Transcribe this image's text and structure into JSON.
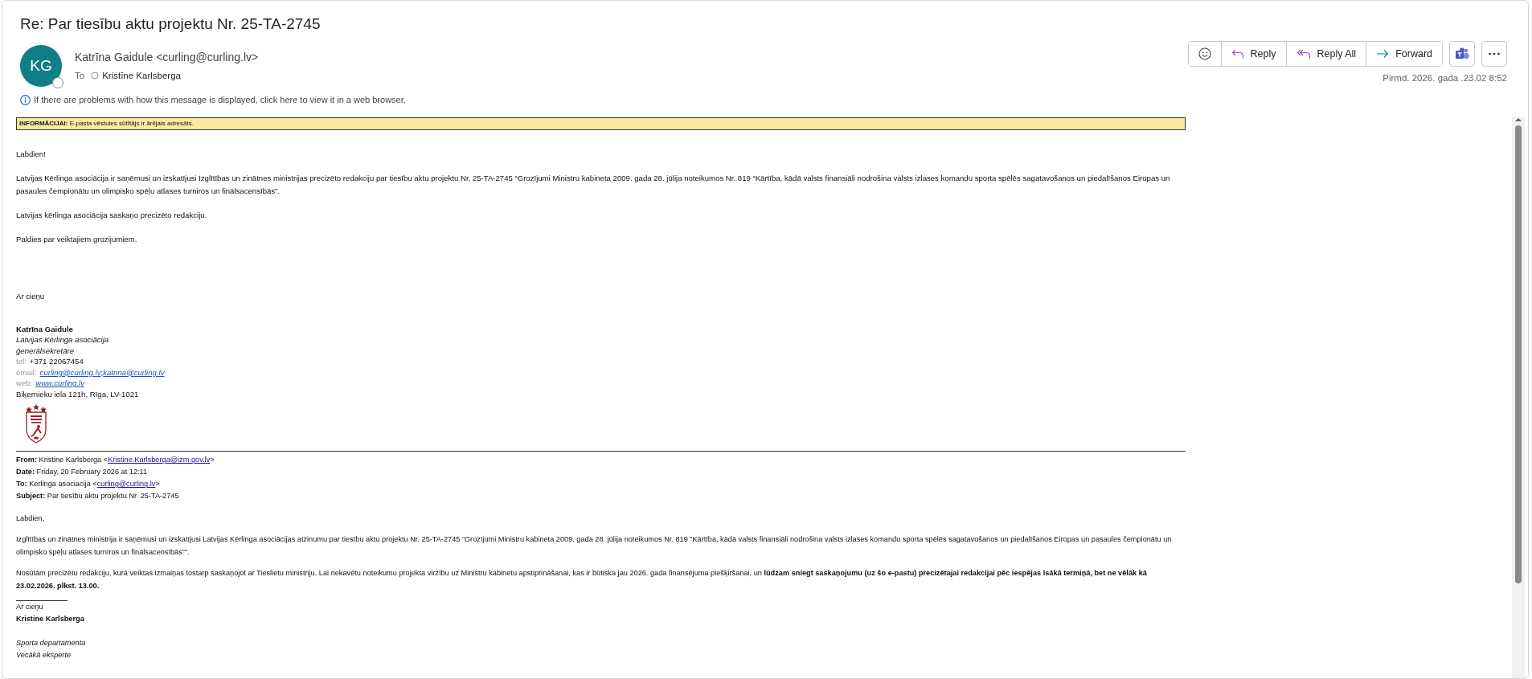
{
  "message": {
    "subject": "Re: Par tiesību aktu projektu Nr. 25-TA-2745",
    "avatar_initials": "KG",
    "sender": "Katrīna Gaidule <curling@curling.lv>",
    "to_label": "To",
    "recipient": "Kristīne Karlsberga",
    "info_notice": "If there are problems with how this message is displayed, click here to view it in a web browser.",
    "date": "Pirmd. 2026.  gada .23.02 8:52"
  },
  "actions": [
    {
      "kind": "emoji"
    },
    {
      "kind": "reply",
      "label": "Reply"
    },
    {
      "kind": "reply_all",
      "label": "Reply All"
    },
    {
      "kind": "forward",
      "label": "Forward"
    },
    {
      "kind": "teams"
    },
    {
      "kind": "more"
    }
  ],
  "banner": {
    "label": "INFORMĀCIJAI:",
    "text": "E-pasta vēstules sūtītājs ir ārējais adresāts."
  },
  "body": {
    "paragraphs": [
      "Labdien!",
      "Latvijas Kērlinga asociācija ir saņēmusi un izskatījusi Izglītības un zinātnes ministrijas precizēto redakciju par tiesību aktu projektu Nr. 25-TA-2745 “Grozījumi Ministru kabineta 2009. gada 28. jūlija noteikumos Nr. 819 “Kārtība, kādā valsts finansiāli nodrošina valsts izlases komandu sporta spēlēs sagatavošanos un piedalīšanos Eiropas un pasaules čempionātu un olimpisko spēļu atlases turniros un finālsacensībās”.",
      "Latvijas kērlinga asociācija saskaņo precizēto redakciju.",
      "Paldies par veiktajiem grozijumiem."
    ]
  },
  "signature": {
    "closing": "Ar cieņu",
    "name": "Katrīna Gaidule",
    "organization": "Latvijas Kērlinga asociācija",
    "role": "ģenerālsekretāre",
    "contacts": [
      {
        "label": "tel:",
        "parts": [
          {
            "text": "+371 22067454"
          }
        ]
      },
      {
        "label": "email:",
        "parts": [
          {
            "link": "curling@curling.lv"
          },
          {
            "text": ";"
          },
          {
            "link": "katrina@curling.lv"
          }
        ]
      },
      {
        "label": "web:",
        "parts": [
          {
            "link": "www.curling.lv"
          }
        ]
      }
    ],
    "address": "Biķernieku iela 121h, Rīga, LV-1021"
  },
  "forwarded": {
    "headers": [
      {
        "label": "From:",
        "value": "Kristine Karlsberga <",
        "link": "Kristine.Karlsberga@izm.gov.lv",
        "suffix": ">"
      },
      {
        "label": "Date:",
        "value": "Friday, 20 February 2026 at 12:11"
      },
      {
        "label": "To:",
        "value": "Kerlinga asociacija <",
        "link": "curling@curling.lv",
        "suffix": ">"
      },
      {
        "label": "Subject:",
        "value": "Par tiesību aktu projektu Nr. 25-TA-2745"
      }
    ],
    "paragraphs": [
      "Labdien,",
      "Izglītības un zinātnes ministrija ir saņēmusi un izskatījusi Latvijas Kērlinga asociācijas atzinumu par tiesību aktu projektu Nr. 25-TA-2745 “Grozījumi Ministru kabineta 2009. gada 28. jūlija noteikumos Nr. 819 “Kārtība, kādā valsts finansiāli nodrošina valsts izlases komandu sporta spēlēs sagatavošanos un piedalīšanos Eiropas un pasaules čempionātu un olimpisko spēļu atlases turnīros un finālsacensībās””.",
      "Nosūtām precizētu redakciju, kurā veiktas izmaiņas tostarp saskaņojot ar Tieslietu ministriju. Lai nekavētu noteikumu projekta virzību uz Ministru kabinetu apstiprināšanai, kas ir būtiska jau 2026. gada finansējuma piešķiršanai, un **lūdzam sniegt saskaņojumu (uz šo e-pastu) precizētajai redakcijai pēc iespējas īsākā termiņā, bet ne vēlāk kā 23.02.2026. plkst. 13.00.**"
    ],
    "closing": "Ar cieņu",
    "name": "Kristine Karlsberga",
    "lines": [
      "Sporta departamenta",
      "Vecākā eksperte"
    ]
  }
}
